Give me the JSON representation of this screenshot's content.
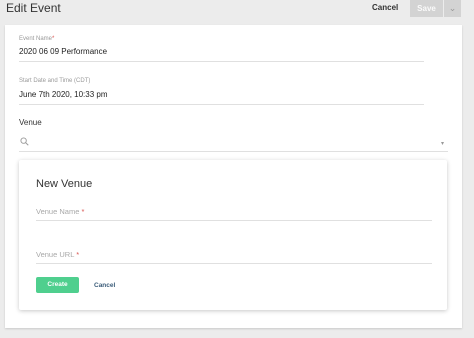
{
  "header": {
    "title": "Edit Event",
    "cancel_label": "Cancel",
    "save_label": "Save",
    "save_toggle_glyph": "⌄"
  },
  "form": {
    "event_name": {
      "label": "Event Name",
      "required_mark": "*",
      "value": "2020 06 09 Performance"
    },
    "start": {
      "label": "Start Date and Time (CDT)",
      "value": "June 7th 2020, 10:33 pm"
    },
    "venue": {
      "label": "Venue",
      "search_value": "",
      "caret_glyph": "▾"
    }
  },
  "new_venue": {
    "title": "New Venue",
    "name_placeholder": "Venue Name",
    "url_placeholder": "Venue URL",
    "required_mark": "*",
    "create_label": "Create",
    "cancel_label": "Cancel"
  },
  "colors": {
    "primary_green": "#4fcf8e",
    "disabled_gray": "#d3d3d3",
    "required_red": "#d9534f",
    "link_blue": "#3c5d7a"
  }
}
